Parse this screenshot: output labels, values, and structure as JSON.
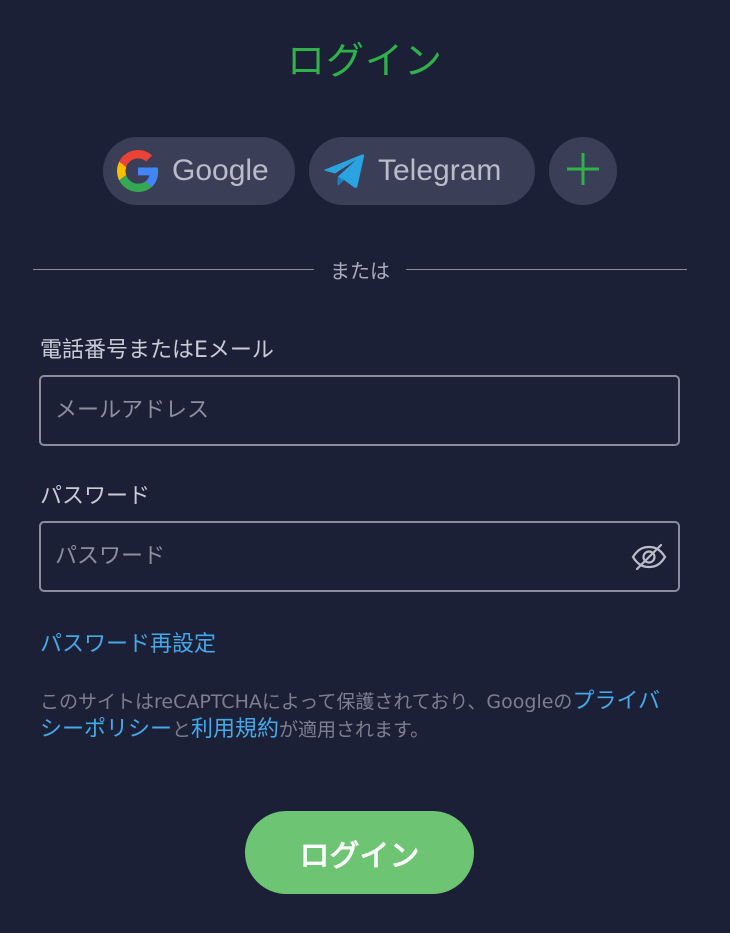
{
  "page": {
    "title": "ログイン"
  },
  "social": {
    "google_label": "Google",
    "telegram_label": "Telegram",
    "more_icon": "plus-icon"
  },
  "divider": {
    "text": "または"
  },
  "email_field": {
    "label": "電話番号またはEメール",
    "placeholder": "メールアドレス",
    "value": ""
  },
  "password_field": {
    "label": "パスワード",
    "placeholder": "パスワード",
    "value": "",
    "toggle_icon": "eye-off-icon"
  },
  "reset_link": "パスワード再設定",
  "legal": {
    "prefix": "このサイトはreCAPTCHAによって保護されており、Googleの",
    "privacy_link": "プライバシーポリシー",
    "middle": "と",
    "terms_link": "利用規約",
    "suffix": "が適用されます。"
  },
  "login_button": "ログイン",
  "colors": {
    "background": "#1c2037",
    "title_green": "#2fb24a",
    "button_green": "#6dc574",
    "link_blue": "#45a8e8",
    "social_bg": "#3a3e57"
  }
}
